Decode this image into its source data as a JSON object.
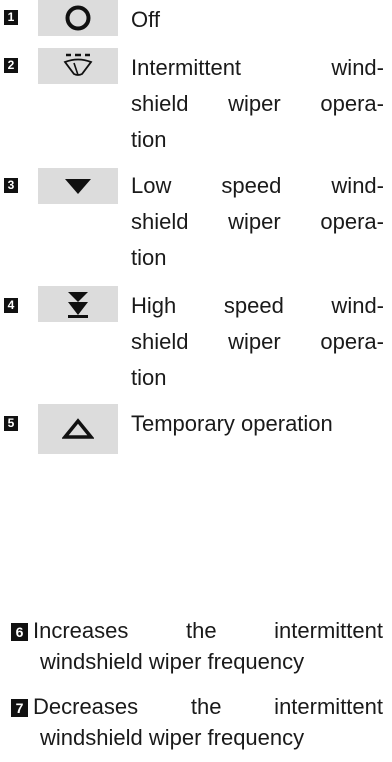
{
  "modes": [
    {
      "number": "1",
      "icon": "off-circle-icon",
      "lines": [
        "Off"
      ]
    },
    {
      "number": "2",
      "icon": "intermittent-wiper-icon",
      "lines": [
        "Intermittent wind-",
        "shield wiper opera-",
        "tion"
      ]
    },
    {
      "number": "3",
      "icon": "low-speed-triangle-icon",
      "lines": [
        "Low speed wind-",
        "shield wiper opera-",
        "tion"
      ]
    },
    {
      "number": "4",
      "icon": "high-speed-double-triangle-icon",
      "lines": [
        "High speed wind-",
        "shield wiper opera-",
        "tion"
      ]
    },
    {
      "number": "5",
      "icon": "temporary-operation-triangle-icon",
      "lines": [
        "Temporary operation"
      ]
    }
  ],
  "notes": [
    {
      "number": "6",
      "lines": [
        "Increases the intermittent",
        "windshield wiper frequency"
      ]
    },
    {
      "number": "7",
      "lines": [
        "Decreases the intermittent",
        "windshield wiper frequency"
      ]
    }
  ],
  "colors": {
    "badge": "#111111",
    "symbol_cell": "#dcdcdc",
    "text": "#1a1a1a"
  }
}
